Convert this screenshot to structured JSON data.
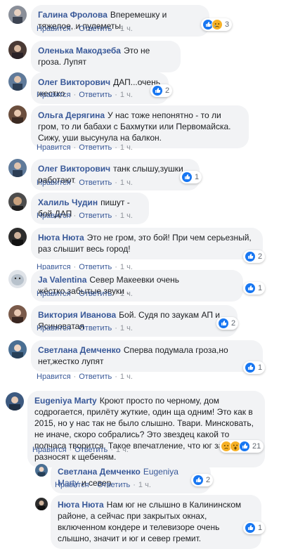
{
  "actions": {
    "like": "Нравится",
    "reply": "Ответить",
    "time": "1 ч."
  },
  "comments": [
    {
      "author": "Галина Фролова",
      "text": "Вперемешку и тяжелое, и пулеметы.",
      "reactions": "3"
    },
    {
      "author": "Оленька Макодзеба",
      "text": "Это не гроза. Лупят",
      "reactions": ""
    },
    {
      "author": "Олег Викторович",
      "text": "ДАП...очень жестко",
      "reactions": "2"
    },
    {
      "author": "Ольга Дерягина",
      "text": "У нас тоже непонятно - то ли гром, то ли бабахи с Бахмутки или Первомайска. Сижу, уши высунула на балкон.",
      "reactions": ""
    },
    {
      "author": "Олег Викторович",
      "text": "танк слышу,зушки работают",
      "reactions": "1"
    },
    {
      "author": "Халиль Чудин",
      "text": "пишут - бой ДАП",
      "reactions": ""
    },
    {
      "author": "Нюта Нюта",
      "text": "Это не гром, это бой! При чем серьезный, раз слышит весь город!",
      "reactions": "2"
    },
    {
      "author": "Ja Valentina",
      "text": "Север Макеевки очень жёстко.забытые звуки .",
      "reactions": "1"
    },
    {
      "author": "Виктория Иванова",
      "text": "Бой. Судя по заукам АП и Ясиноватая",
      "reactions": "2"
    },
    {
      "author": "Светлана Демченко",
      "text": "Сперва подумала гроза,но нет,жестко лупят",
      "reactions": "1"
    },
    {
      "author": "Eugeniya Marty",
      "text": "Кроют просто по черному, дом содрогается, прилёту жуткие, один ща одним! Это как в 2015, но у нас так не было слышно. Твари. Минсковать, не иначе, скоро собрались? Это звездец какой то полчаса творится. Такое впечатление, что юг за городом разносят к щебеням.",
      "reactions": "21"
    },
    {
      "author": "Светлана Демченко",
      "mention": "Eugeniya Marty",
      "text": "и север",
      "reactions": "2"
    },
    {
      "author": "Нюта Нюта",
      "text": "Нам юг не слышно в Калининском районе, а сейчас при закрытых окнах, включенном кондере и телевизоре очень слышно, значит и юг и север гремит.",
      "reactions": "1"
    }
  ],
  "colors": {
    "like": "#1877f2",
    "haha": "#f7b125",
    "wow": "#f7b125",
    "sad": "#f7b125",
    "link": "#385898"
  }
}
